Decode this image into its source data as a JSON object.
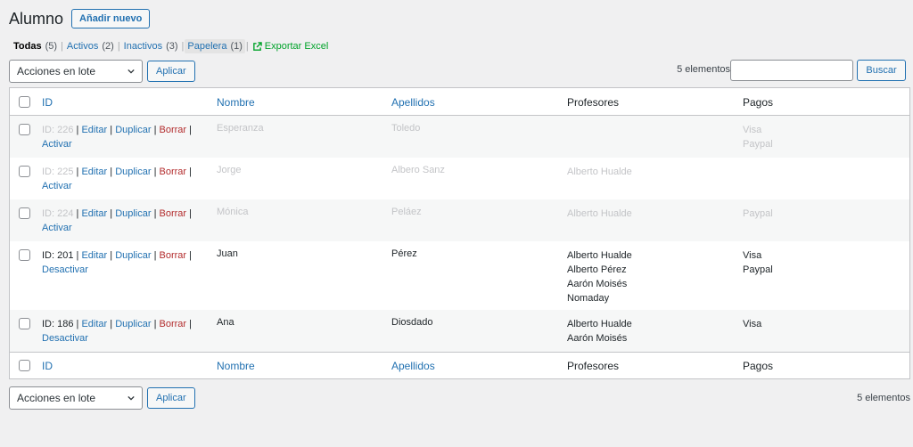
{
  "header": {
    "title": "Alumno",
    "add_new": "Añadir nuevo"
  },
  "views": [
    {
      "label": "Todas",
      "count": "(5)"
    },
    {
      "label": "Activos",
      "count": "(2)"
    },
    {
      "label": "Inactivos",
      "count": "(3)"
    },
    {
      "label": "Papelera",
      "count": "(1)"
    }
  ],
  "export_label": "Exportar Excel",
  "bulk": {
    "select_label": "Acciones en lote",
    "apply": "Aplicar"
  },
  "count_label": "5 elementos",
  "search": {
    "button": "Buscar",
    "value": ""
  },
  "columns": {
    "id": "ID",
    "nombre": "Nombre",
    "apellidos": "Apellidos",
    "profesores": "Profesores",
    "pagos": "Pagos"
  },
  "actions": {
    "edit": "Editar",
    "duplicate": "Duplicar",
    "delete": "Borrar"
  },
  "rows": [
    {
      "id": "ID: 226",
      "toggle": "Activar",
      "nombre": "Esperanza",
      "apellidos": "Toledo",
      "profesores": [],
      "pagos": [
        "Visa",
        "Paypal"
      ]
    },
    {
      "id": "ID: 225",
      "toggle": "Activar",
      "nombre": "Jorge",
      "apellidos": "Albero Sanz",
      "profesores": [
        "Alberto Hualde"
      ],
      "pagos": []
    },
    {
      "id": "ID: 224",
      "toggle": "Activar",
      "nombre": "Mónica",
      "apellidos": "Peláez",
      "profesores": [
        "Alberto Hualde"
      ],
      "pagos": [
        "Paypal"
      ]
    },
    {
      "id": "ID: 201",
      "toggle": "Desactivar",
      "nombre": "Juan",
      "apellidos": "Pérez",
      "profesores": [
        "Alberto Hualde",
        "Alberto Pérez",
        "Aarón Moisés",
        "Nomaday"
      ],
      "pagos": [
        "Visa",
        "Paypal"
      ]
    },
    {
      "id": "ID: 186",
      "toggle": "Desactivar",
      "nombre": "Ana",
      "apellidos": "Diosdado",
      "profesores": [
        "Alberto Hualde",
        "Aarón Moisés"
      ],
      "pagos": [
        "Visa"
      ]
    }
  ],
  "colors": {
    "link": "#2271b1",
    "delete": "#b32d2e",
    "export": "#00a32a",
    "inactive_text": "#c3c4c7"
  }
}
